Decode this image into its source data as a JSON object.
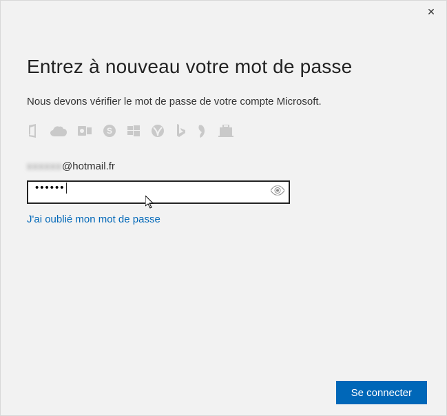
{
  "window": {
    "close_glyph": "✕"
  },
  "title": "Entrez à nouveau votre mot de passe",
  "subtitle": "Nous devons vérifier le mot de passe de votre compte Microsoft.",
  "icons": [
    "office-icon",
    "onedrive-icon",
    "outlook-icon",
    "skype-icon",
    "windows-icon",
    "xbox-icon",
    "bing-icon",
    "msn-icon",
    "store-icon"
  ],
  "account": {
    "masked_user": "xxxxxx",
    "domain": "@hotmail.fr"
  },
  "password": {
    "value_mask": "••••••",
    "placeholder": ""
  },
  "links": {
    "forgot": "J'ai oublié mon mot de passe"
  },
  "buttons": {
    "signin": "Se connecter"
  }
}
